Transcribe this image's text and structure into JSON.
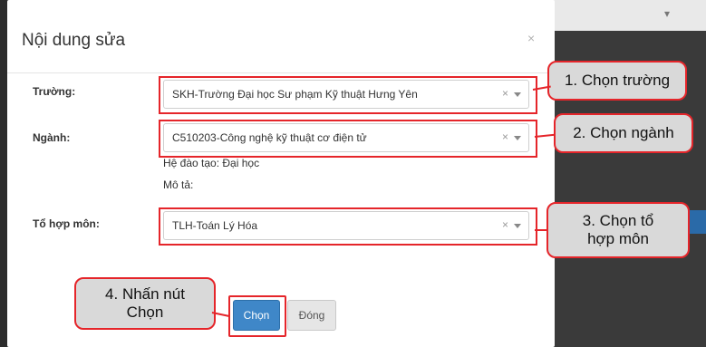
{
  "modal": {
    "title": "Nội dung sửa",
    "close_glyph": "×"
  },
  "form": {
    "truong": {
      "label": "Trường:",
      "value": "SKH-Trường Đại học Sư phạm Kỹ thuật Hưng Yên"
    },
    "nganh": {
      "label": "Ngành:",
      "value": "C510203-Công nghệ kỹ thuật cơ điện tử"
    },
    "he_dao_tao": "Hệ đào tạo: Đại học",
    "mo_ta": "Mô tả:",
    "to_hop_mon": {
      "label": "Tổ hợp môn:",
      "value": "TLH-Toán Lý Hóa"
    },
    "clear_glyph": "×"
  },
  "buttons": {
    "chon": "Chọn",
    "dong": "Đóng"
  },
  "callouts": {
    "step1": "1. Chọn trường",
    "step2": "2. Chọn ngành",
    "step3_line1": "3. Chọn tổ",
    "step3_line2": "hợp môn",
    "step4_line1": "4. Nhấn nút",
    "step4_line2": "Chọn"
  },
  "colors": {
    "highlight": "#e5252a",
    "primary": "#3f87c8",
    "callout_bg": "#d9d9d9"
  }
}
